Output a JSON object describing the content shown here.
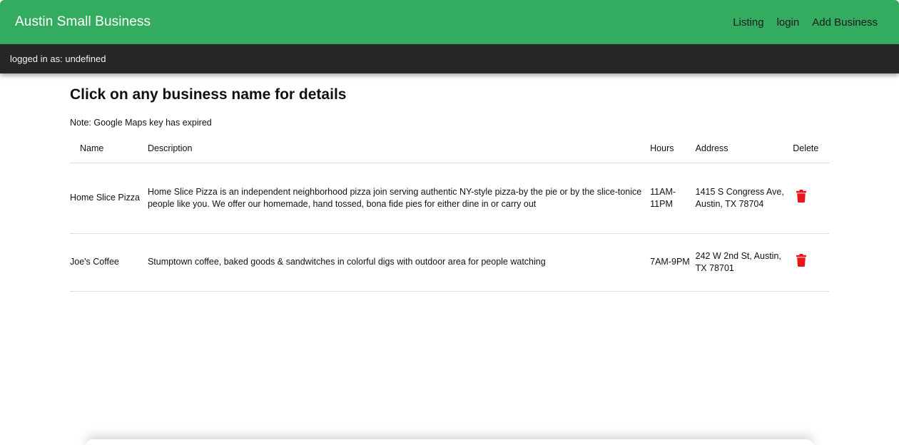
{
  "navbar": {
    "brand": "Austin Small Business",
    "links": [
      "Listing",
      "login",
      "Add Business"
    ]
  },
  "status": {
    "text": "logged in as: undefined"
  },
  "main": {
    "title": "Click on any business name for details",
    "note": "Note: Google Maps key has expired",
    "columns": [
      "Name",
      "Description",
      "Hours",
      "Address",
      "Delete"
    ],
    "rows": [
      {
        "name": "Home Slice Pizza",
        "description": "Home Slice Pizza is an independent neighborhood pizza join serving authentic NY-style pizza-by the pie or by the slice-tonice people like you. We offer our homemade, hand tossed, bona fide pies for either dine in or carry out",
        "hours": "11AM-11PM",
        "address": "1415 S Congress Ave, Austin, TX 78704",
        "delete_icon": "trash-icon"
      },
      {
        "name": "Joe's Coffee",
        "description": "Stumptown coffee, baked goods & sandwitches in colorful digs with outdoor area for people watching",
        "hours": "7AM-9PM",
        "address": "242 W 2nd St, Austin, TX 78701",
        "delete_icon": "trash-icon"
      }
    ]
  },
  "colors": {
    "navbar": "#34ac60",
    "statusbar": "#262626",
    "delete": "#e8161b"
  }
}
